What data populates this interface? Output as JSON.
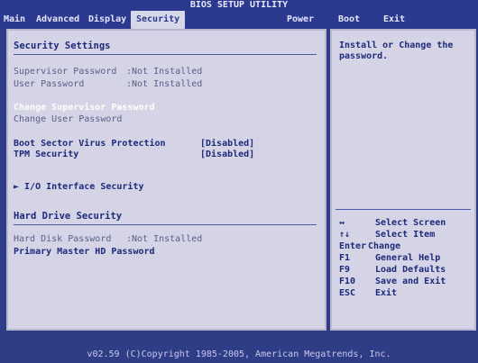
{
  "title": "BIOS SETUP UTILITY",
  "menu": [
    {
      "label": "Main"
    },
    {
      "label": "Advanced"
    },
    {
      "label": "Display"
    },
    {
      "label": "Security",
      "active": true
    },
    {
      "label": "Power"
    },
    {
      "label": "Boot"
    },
    {
      "label": "Exit"
    }
  ],
  "security": {
    "section_title": "Security Settings",
    "supervisor_label": "Supervisor Password",
    "supervisor_value": ":Not Installed",
    "user_label": "User Password",
    "user_value": ":Not Installed",
    "change_supervisor": "Change Supervisor Password",
    "change_user": "Change User Password",
    "boot_sector_label": "Boot Sector Virus Protection",
    "boot_sector_value": "[Disabled]",
    "tpm_label": "TPM Security",
    "tpm_value": "[Disabled]",
    "io_interface": "► I/O Interface Security",
    "hdd_section_title": "Hard Drive Security",
    "hdd_password_label": "Hard Disk Password",
    "hdd_password_value": ":Not Installed",
    "primary_master": "Primary Master HD Password"
  },
  "help": {
    "description": "Install or Change the\npassword.",
    "keys": [
      {
        "key": "↔",
        "desc": "Select Screen"
      },
      {
        "key": "↑↓",
        "desc": "Select Item"
      },
      {
        "key": "Enter",
        "desc": "Change"
      },
      {
        "key": "F1",
        "desc": "General Help"
      },
      {
        "key": "F9",
        "desc": "Load Defaults"
      },
      {
        "key": "F10",
        "desc": "Save and Exit"
      },
      {
        "key": "ESC",
        "desc": "Exit"
      }
    ]
  },
  "footer": "v02.59 (C)Copyright 1985-2005, American Megatrends, Inc."
}
